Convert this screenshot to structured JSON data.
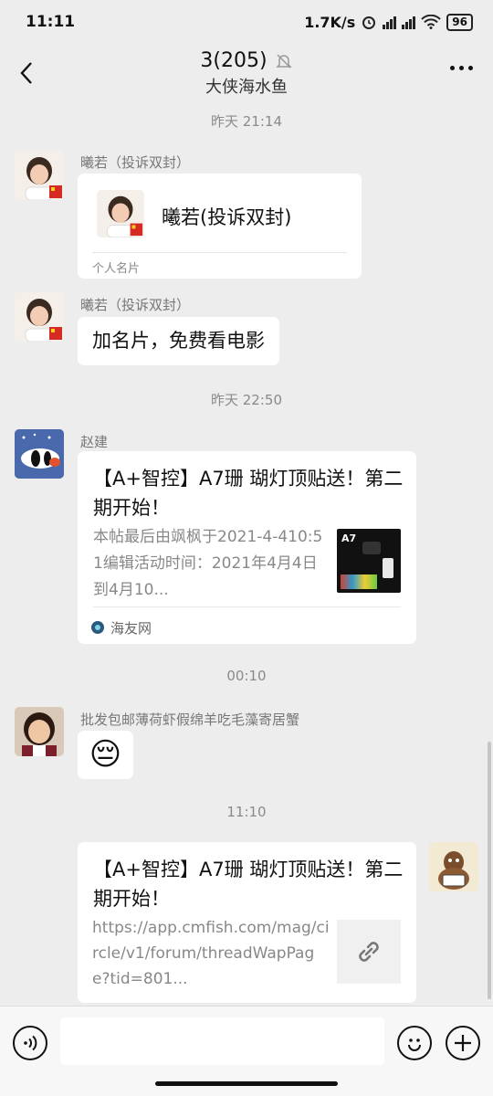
{
  "status": {
    "time": "11:11",
    "speed": "1.7K/s",
    "battery": "96"
  },
  "header": {
    "title": "3(205)",
    "subtitle": "大侠海水鱼"
  },
  "messages": [
    {
      "type": "time",
      "text": "昨天 21:14"
    },
    {
      "type": "card",
      "sender": "曦若（投诉双封）",
      "card_name": "曦若(投诉双封)",
      "card_footer": "个人名片"
    },
    {
      "type": "text",
      "sender": "曦若（投诉双封）",
      "text": "加名片，免费看电影"
    },
    {
      "type": "time",
      "text": "昨天 22:50"
    },
    {
      "type": "link",
      "sender": "赵建",
      "title": "【A+智控】A7珊 瑚灯顶贴送！第二期开始！",
      "desc": "本帖最后由飒枫于2021-4-410:51编辑活动时间：2021年4月4日到4月10...",
      "source": "海友网",
      "thumb_label": "A7"
    },
    {
      "type": "time",
      "text": "00:10"
    },
    {
      "type": "emoji",
      "sender": "批发包邮薄荷虾假绵羊吃毛藻寄居蟹",
      "emoji": "😔"
    },
    {
      "type": "time",
      "text": "11:10"
    },
    {
      "type": "link_out",
      "title": "【A+智控】A7珊 瑚灯顶贴送！第二期开始！",
      "desc": "https://app.cmfish.com/mag/circle/v1/forum/threadWapPage?tid=801..."
    }
  ]
}
